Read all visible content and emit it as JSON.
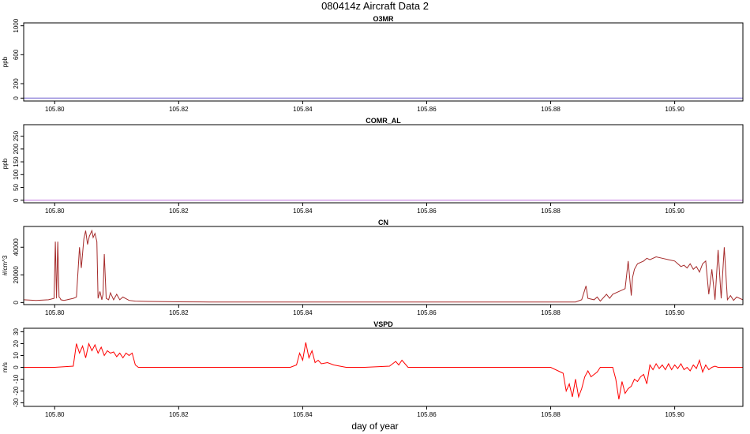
{
  "figure": {
    "title": "080414z   Aircraft Data 2",
    "xlabel": "day of year"
  },
  "chart_data": [
    {
      "type": "line",
      "title": "O3MR",
      "ylabel": "ppb",
      "xlim": [
        105.795,
        105.911
      ],
      "ylim": [
        -40,
        1040
      ],
      "xticks": [
        105.8,
        105.82,
        105.84,
        105.86,
        105.88,
        105.9
      ],
      "xtick_labels": [
        "105.80",
        "105.82",
        "105.84",
        "105.86",
        "105.88",
        "105.90"
      ],
      "yticks": [
        0,
        200,
        600,
        1000
      ],
      "ytick_labels": [
        "0",
        "200",
        "600",
        "1000"
      ],
      "series": [
        {
          "color": "#6a5acd",
          "x": [
            105.795,
            105.911
          ],
          "y": [
            0,
            0
          ]
        }
      ]
    },
    {
      "type": "line",
      "title": "COMR_AL",
      "ylabel": "ppb",
      "xlim": [
        105.795,
        105.911
      ],
      "ylim": [
        -10,
        295
      ],
      "xticks": [
        105.8,
        105.82,
        105.84,
        105.86,
        105.88,
        105.9
      ],
      "xtick_labels": [
        "105.80",
        "105.82",
        "105.84",
        "105.86",
        "105.88",
        "105.90"
      ],
      "yticks": [
        0,
        50,
        100,
        150,
        200,
        250
      ],
      "ytick_labels": [
        "0",
        "50",
        "100",
        "150",
        "200",
        "250"
      ],
      "series": [
        {
          "color": "#c071e0",
          "x": [
            105.795,
            105.911
          ],
          "y": [
            0,
            0
          ]
        }
      ]
    },
    {
      "type": "line",
      "title": "CN",
      "ylabel": "#/cm^3",
      "xlim": [
        105.795,
        105.911
      ],
      "ylim": [
        -1500,
        55000
      ],
      "xticks": [
        105.8,
        105.82,
        105.84,
        105.86,
        105.88,
        105.9
      ],
      "xtick_labels": [
        "105.80",
        "105.82",
        "105.84",
        "105.86",
        "105.88",
        "105.90"
      ],
      "yticks": [
        0,
        20000,
        40000
      ],
      "ytick_labels": [
        "0",
        "20000",
        "40000"
      ],
      "series": [
        {
          "color": "#a52a2a",
          "x": [
            105.795,
            105.797,
            105.799,
            105.7999,
            105.8001,
            105.8003,
            105.8005,
            105.8007,
            105.8009,
            105.801,
            105.8015,
            105.802,
            105.803,
            105.8035,
            105.804,
            105.8043,
            105.8047,
            105.805,
            105.8053,
            105.8056,
            105.806,
            105.8062,
            105.8065,
            105.8068,
            105.807,
            105.8073,
            105.8076,
            105.8078,
            105.808,
            105.8083,
            105.8087,
            105.809,
            105.8095,
            105.81,
            105.8105,
            105.811,
            105.812,
            105.813,
            105.815,
            105.82,
            105.825,
            105.83,
            105.84,
            105.85,
            105.86,
            105.87,
            105.88,
            105.884,
            105.885,
            105.8857,
            105.886,
            105.887,
            105.8875,
            105.888,
            105.889,
            105.8895,
            105.89,
            105.891,
            105.892,
            105.8925,
            105.893,
            105.8932,
            105.8935,
            105.894,
            105.895,
            105.8955,
            105.896,
            105.897,
            105.898,
            105.899,
            105.9,
            105.9005,
            105.901,
            105.9015,
            105.902,
            105.9025,
            105.903,
            105.9035,
            105.904,
            105.9045,
            105.905,
            105.9055,
            105.906,
            105.9065,
            105.907,
            105.9075,
            105.908,
            105.9085,
            105.909,
            105.9095,
            105.91,
            105.911
          ],
          "y": [
            2000,
            1500,
            2000,
            3000,
            44000,
            3000,
            44000,
            4000,
            3000,
            2000,
            1500,
            2000,
            3000,
            4000,
            40000,
            25000,
            46000,
            52000,
            42000,
            48000,
            52000,
            47000,
            50000,
            44000,
            3000,
            8000,
            2000,
            6000,
            35000,
            3000,
            2000,
            7000,
            2000,
            6000,
            2000,
            4000,
            1500,
            1000,
            800,
            500,
            400,
            300,
            300,
            300,
            300,
            300,
            300,
            400,
            2000,
            12000,
            3000,
            2000,
            4000,
            1000,
            6000,
            3000,
            6000,
            8000,
            10000,
            30000,
            5000,
            18000,
            24000,
            28000,
            30000,
            32000,
            31000,
            33000,
            32000,
            31000,
            30000,
            28000,
            26000,
            27000,
            25000,
            28000,
            24000,
            26000,
            22000,
            28000,
            30000,
            6000,
            24000,
            2000,
            38000,
            3000,
            40000,
            2000,
            5000,
            1500,
            4000,
            2000
          ]
        }
      ]
    },
    {
      "type": "line",
      "title": "VSPD",
      "ylabel": "m/s",
      "xlim": [
        105.795,
        105.911
      ],
      "ylim": [
        -33,
        33
      ],
      "xticks": [
        105.8,
        105.82,
        105.84,
        105.86,
        105.88,
        105.9
      ],
      "xtick_labels": [
        "105.80",
        "105.82",
        "105.84",
        "105.86",
        "105.88",
        "105.90"
      ],
      "yticks": [
        -30,
        -20,
        -10,
        0,
        10,
        20,
        30
      ],
      "ytick_labels": [
        "-30",
        "-20",
        "-10",
        "0",
        "10",
        "20",
        "30"
      ],
      "series": [
        {
          "color": "#ff0000",
          "x": [
            105.795,
            105.8,
            105.803,
            105.8035,
            105.804,
            105.8045,
            105.805,
            105.8055,
            105.806,
            105.8065,
            105.807,
            105.8075,
            105.808,
            105.8085,
            105.809,
            105.8095,
            105.81,
            105.8105,
            105.811,
            105.8115,
            105.812,
            105.8125,
            105.813,
            105.8135,
            105.814,
            105.82,
            105.83,
            105.838,
            105.839,
            105.8395,
            105.84,
            105.8405,
            105.841,
            105.8415,
            105.842,
            105.8425,
            105.843,
            105.844,
            105.845,
            105.846,
            105.847,
            105.85,
            105.854,
            105.855,
            105.8555,
            105.856,
            105.8565,
            105.857,
            105.86,
            105.87,
            105.88,
            105.882,
            105.8825,
            105.883,
            105.8835,
            105.884,
            105.8845,
            105.885,
            105.8855,
            105.886,
            105.8865,
            105.887,
            105.8875,
            105.888,
            105.8885,
            105.889,
            105.8895,
            105.89,
            105.8905,
            105.891,
            105.8915,
            105.892,
            105.8925,
            105.893,
            105.8935,
            105.894,
            105.8945,
            105.895,
            105.8955,
            105.896,
            105.8965,
            105.897,
            105.8975,
            105.898,
            105.8985,
            105.899,
            105.8995,
            105.9,
            105.9005,
            105.901,
            105.9015,
            105.902,
            105.9025,
            105.903,
            105.9035,
            105.904,
            105.9045,
            105.905,
            105.9055,
            105.906,
            105.9065,
            105.907,
            105.911
          ],
          "y": [
            0,
            0,
            1,
            20,
            12,
            18,
            8,
            20,
            14,
            19,
            12,
            17,
            10,
            14,
            12,
            13,
            9,
            12,
            8,
            12,
            10,
            12,
            2,
            0,
            0,
            0,
            0,
            0,
            2,
            12,
            6,
            21,
            8,
            14,
            4,
            6,
            3,
            4,
            2,
            1,
            0,
            0,
            1,
            5,
            2,
            6,
            3,
            0,
            0,
            0,
            0,
            -5,
            -20,
            -14,
            -25,
            -10,
            -25,
            -18,
            -8,
            -3,
            -8,
            -6,
            -4,
            0,
            0,
            0,
            0,
            0,
            -10,
            -27,
            -12,
            -22,
            -18,
            -16,
            -10,
            -12,
            -8,
            -6,
            -14,
            2,
            -2,
            3,
            -1,
            2,
            -2,
            3,
            -2,
            2,
            -1,
            3,
            -2,
            0,
            -3,
            2,
            -1,
            6,
            -4,
            2,
            -2,
            0,
            1,
            0,
            0
          ]
        }
      ]
    }
  ]
}
